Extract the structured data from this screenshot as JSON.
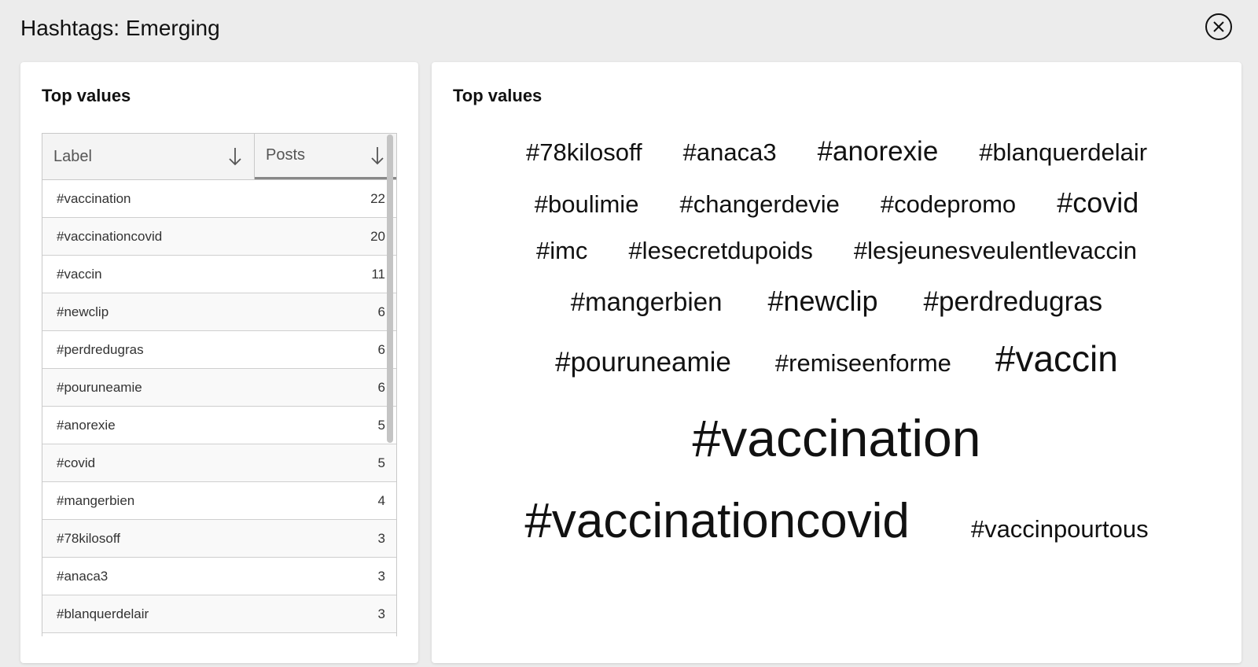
{
  "window": {
    "title": "Hashtags: Emerging",
    "close_icon": "close-circle-icon"
  },
  "table_panel": {
    "heading": "Top values",
    "columns": [
      {
        "label": "Label",
        "sort_icon": "arrow-down-icon"
      },
      {
        "label": "Posts",
        "sort_icon": "arrow-down-icon"
      }
    ],
    "rows": [
      {
        "label": "#vaccination",
        "posts": "22"
      },
      {
        "label": "#vaccinationcovid",
        "posts": "20"
      },
      {
        "label": "#vaccin",
        "posts": "11"
      },
      {
        "label": "#newclip",
        "posts": "6"
      },
      {
        "label": "#perdredugras",
        "posts": "6"
      },
      {
        "label": "#pouruneamie",
        "posts": "6"
      },
      {
        "label": "#anorexie",
        "posts": "5"
      },
      {
        "label": "#covid",
        "posts": "5"
      },
      {
        "label": "#mangerbien",
        "posts": "4"
      },
      {
        "label": "#78kilosoff",
        "posts": "3"
      },
      {
        "label": "#anaca3",
        "posts": "3"
      },
      {
        "label": "#blanquerdelair",
        "posts": "3"
      }
    ]
  },
  "cloud_panel": {
    "heading": "Top values",
    "rows": [
      [
        "#78kilosoff",
        "#anaca3",
        "#anorexie",
        "#blanquerdelair"
      ],
      [
        "#boulimie",
        "#changerdevie",
        "#codepromo",
        "#covid"
      ],
      [
        "#imc",
        "#lesecretdupoids",
        "#lesjeunesveulentlevaccin"
      ],
      [
        "#mangerbien",
        "#newclip",
        "#perdredugras"
      ],
      [
        "#pouruneamie",
        "#remiseenforme",
        "#vaccin"
      ],
      [
        "#vaccination"
      ],
      [
        "#vaccinationcovid",
        "#vaccinpourtous"
      ]
    ]
  }
}
